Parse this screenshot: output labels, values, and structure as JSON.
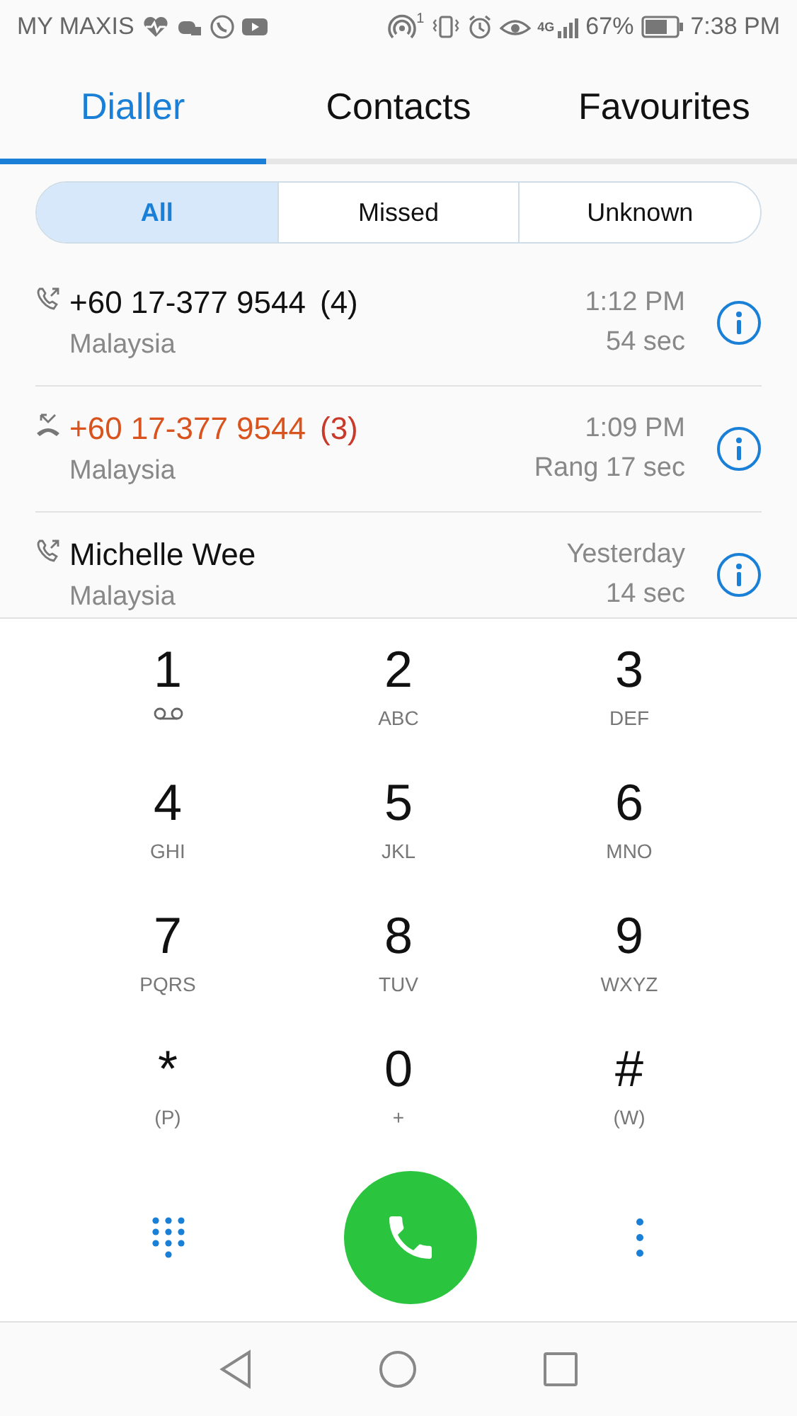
{
  "status_bar": {
    "carrier": "MY MAXIS",
    "hotspot_count": "1",
    "network": "4G",
    "battery": "67%",
    "time": "7:38 PM"
  },
  "tabs": [
    {
      "label": "Dialler",
      "selected": true
    },
    {
      "label": "Contacts",
      "selected": false
    },
    {
      "label": "Favourites",
      "selected": false
    }
  ],
  "filters": [
    {
      "label": "All",
      "selected": true
    },
    {
      "label": "Missed",
      "selected": false
    },
    {
      "label": "Unknown",
      "selected": false
    }
  ],
  "calls": [
    {
      "kind": "outgoing",
      "name": "+60 17-377 9544",
      "count": "(4)",
      "location": "Malaysia",
      "time": "1:12 PM",
      "duration": "54 sec"
    },
    {
      "kind": "missed",
      "name": "+60 17-377 9544",
      "count": "(3)",
      "location": "Malaysia",
      "time": "1:09 PM",
      "duration": "Rang 17 sec"
    },
    {
      "kind": "outgoing",
      "name": "Michelle Wee",
      "location": "Malaysia",
      "time": "Yesterday",
      "duration": "14 sec"
    }
  ],
  "keys": [
    {
      "digit": "1",
      "kind": "voicemail"
    },
    {
      "digit": "2",
      "kind": "letters",
      "sub": "ABC"
    },
    {
      "digit": "3",
      "kind": "letters",
      "sub": "DEF"
    },
    {
      "digit": "4",
      "kind": "letters",
      "sub": "GHI"
    },
    {
      "digit": "5",
      "kind": "letters",
      "sub": "JKL"
    },
    {
      "digit": "6",
      "kind": "letters",
      "sub": "MNO"
    },
    {
      "digit": "7",
      "kind": "letters",
      "sub": "PQRS"
    },
    {
      "digit": "8",
      "kind": "letters",
      "sub": "TUV"
    },
    {
      "digit": "9",
      "kind": "letters",
      "sub": "WXYZ"
    },
    {
      "digit": "*",
      "kind": "letters",
      "sub": "(P)"
    },
    {
      "digit": "0",
      "kind": "letters",
      "sub": "+"
    },
    {
      "digit": "#",
      "kind": "letters",
      "sub": "(W)"
    }
  ]
}
